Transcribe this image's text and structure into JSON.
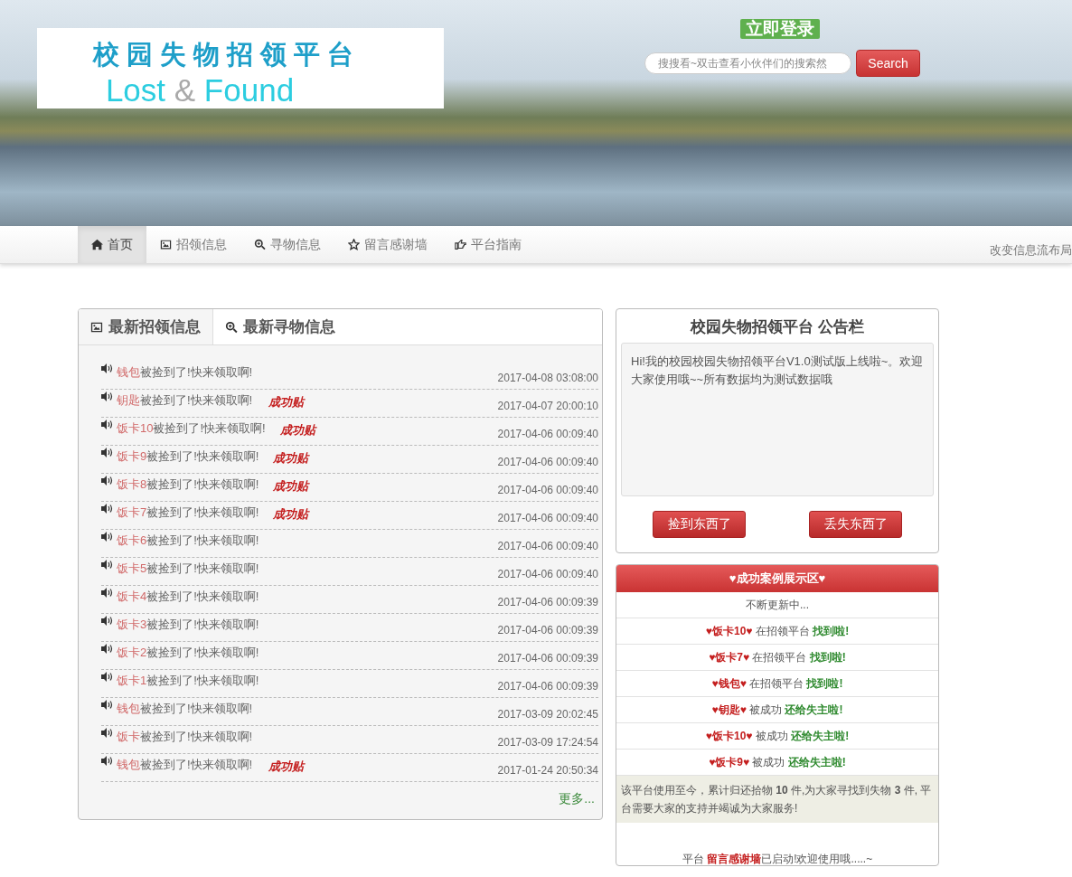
{
  "header": {
    "logo_cn": "校园失物招领平台",
    "logo_en_1": "Lost",
    "logo_en_amp": "&",
    "logo_en_2": "Found",
    "login": "立即登录",
    "search": {
      "placeholder": "搜搜看~双击查看小伙伴们的搜索然"
    },
    "search_button": "Search"
  },
  "nav": {
    "items": [
      {
        "label": "首页",
        "selected": true
      },
      {
        "label": "招领信息",
        "selected": false
      },
      {
        "label": "寻物信息",
        "selected": false
      },
      {
        "label": "留言感谢墙",
        "selected": false
      },
      {
        "label": "平台指南",
        "selected": false
      }
    ],
    "right_link": "改变信息流布局"
  },
  "feed": {
    "tabs": [
      {
        "label": "最新招领信息",
        "selected": true
      },
      {
        "label": "最新寻物信息",
        "selected": false
      }
    ],
    "rows": [
      {
        "item": "钱包",
        "text": "被捡到了!快来领取啊!",
        "date": "2017-04-08 03:08:00"
      },
      {
        "item": "钥匙",
        "text": "被捡到了!快来领取啊!",
        "badge": "成功贴",
        "date": "2017-04-07 20:00:10"
      },
      {
        "item": "饭卡10",
        "text": "被捡到了!快来领取啊!",
        "badge": "成功贴",
        "date": "2017-04-06 00:09:40"
      },
      {
        "item": "饭卡9",
        "text": "被捡到了!快来领取啊!",
        "badge": "成功贴",
        "date": "2017-04-06 00:09:40"
      },
      {
        "item": "饭卡8",
        "text": "被捡到了!快来领取啊!",
        "badge": "成功贴",
        "date": "2017-04-06 00:09:40"
      },
      {
        "item": "饭卡7",
        "text": "被捡到了!快来领取啊!",
        "badge": "成功贴",
        "date": "2017-04-06 00:09:40"
      },
      {
        "item": "饭卡6",
        "text": "被捡到了!快来领取啊!",
        "date": "2017-04-06 00:09:40"
      },
      {
        "item": "饭卡5",
        "text": "被捡到了!快来领取啊!",
        "date": "2017-04-06 00:09:40"
      },
      {
        "item": "饭卡4",
        "text": "被捡到了!快来领取啊!",
        "date": "2017-04-06 00:09:39"
      },
      {
        "item": "饭卡3",
        "text": "被捡到了!快来领取啊!",
        "date": "2017-04-06 00:09:39"
      },
      {
        "item": "饭卡2",
        "text": "被捡到了!快来领取啊!",
        "date": "2017-04-06 00:09:39"
      },
      {
        "item": "饭卡1",
        "text": "被捡到了!快来领取啊!",
        "date": "2017-04-06 00:09:39"
      },
      {
        "item": "钱包",
        "text": "被捡到了!快来领取啊!",
        "date": "2017-03-09 20:02:45"
      },
      {
        "item": "饭卡",
        "text": "被捡到了!快来领取啊!",
        "date": "2017-03-09 17:24:54"
      },
      {
        "item": "钱包",
        "text": "被捡到了!快来领取啊!",
        "badge": "成功贴",
        "date": "2017-01-24 20:50:34"
      }
    ],
    "more": "更多..."
  },
  "notice": {
    "title": "校园失物招领平台 公告栏",
    "body": "Hi!我的校园校园失物招领平台V1.0测试版上线啦~。欢迎大家使用哦~~所有数据均为测试数据哦",
    "buttons": [
      "捡到东西了",
      "丢失东西了"
    ]
  },
  "cases": {
    "title": "♥成功案例展示区♥",
    "subtitle": "不断更新中...",
    "items": [
      {
        "item": "♥饭卡10♥",
        "action": "在招领平台",
        "result": "找到啦!"
      },
      {
        "item": "♥饭卡7♥",
        "action": "在招领平台",
        "result": "找到啦!"
      },
      {
        "item": "♥钱包♥",
        "action": "在招领平台",
        "result": "找到啦!"
      },
      {
        "item": "♥钥匙♥",
        "action": "被成功",
        "result": "还给失主啦!"
      },
      {
        "item": "♥饭卡10♥",
        "action": "被成功",
        "result": "还给失主啦!"
      },
      {
        "item": "♥饭卡9♥",
        "action": "被成功",
        "result": "还给失主啦!"
      }
    ],
    "stats": "该平台使用至今，累计归还拾物 **10** 件,为大家寻找到失物 **3** 件, 平台需要大家的支持并竭诚为大家服务!",
    "footer_prefix": "平台",
    "footer_link": "留言感谢墙",
    "footer_suffix": "已启动!欢迎使用哦.....~"
  }
}
